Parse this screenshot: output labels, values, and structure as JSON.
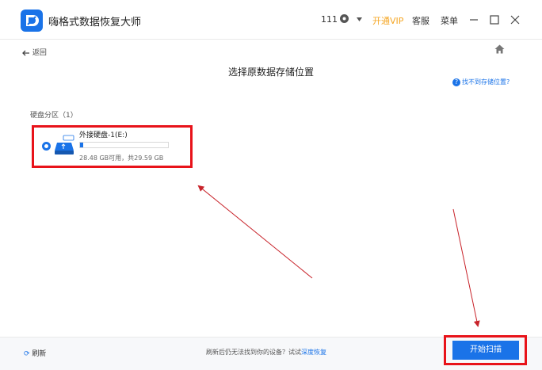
{
  "titlebar": {
    "app_title": "嗨格式数据恢复大师",
    "user_count": "111",
    "vip_label": "开通VIP",
    "service_label": "客服",
    "menu_label": "菜单"
  },
  "nav": {
    "back_label": "返回"
  },
  "main": {
    "title": "选择原数据存储位置",
    "help_link": "找不到存储位置?",
    "section_title": "硬盘分区（1）",
    "drive": {
      "name": "外接硬盘-1(E:)",
      "size_text": "28.48 GB可用，共29.59 GB",
      "used_fraction": 0.04
    }
  },
  "footer": {
    "refresh_label": "刷新",
    "message": "刷新后仍无法找到你的设备？试试",
    "deep_link": "深度恢复",
    "scan_button": "开始扫描"
  },
  "colors": {
    "accent": "#1a73e8",
    "highlight": "#e8131a",
    "vip": "#f5a623"
  }
}
